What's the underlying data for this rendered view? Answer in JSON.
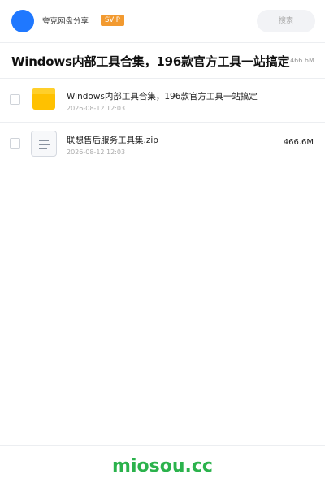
{
  "header": {
    "username": "夸克网盘分享",
    "badge": "SVIP",
    "search_label": "搜索"
  },
  "title": {
    "text": "Windows内部工具合集，196款官方工具一站搞定",
    "size": "· 466.6M"
  },
  "files": [
    {
      "name": "Windows内部工具合集，196款官方工具一站搞定",
      "date": "2026-08-12 12:03",
      "size": "",
      "icon": "folder-icon"
    },
    {
      "name": "联想售后服务工具集.zip",
      "date": "2026-08-12 12:03",
      "size": "466.6M",
      "icon": "zip-file-icon"
    }
  ],
  "footer": {
    "brand": "miosou.cc"
  },
  "colors": {
    "avatar": "#1f78ff",
    "svip": "#f29a30",
    "folder": "#ffc100",
    "brand": "#2bb24c"
  }
}
